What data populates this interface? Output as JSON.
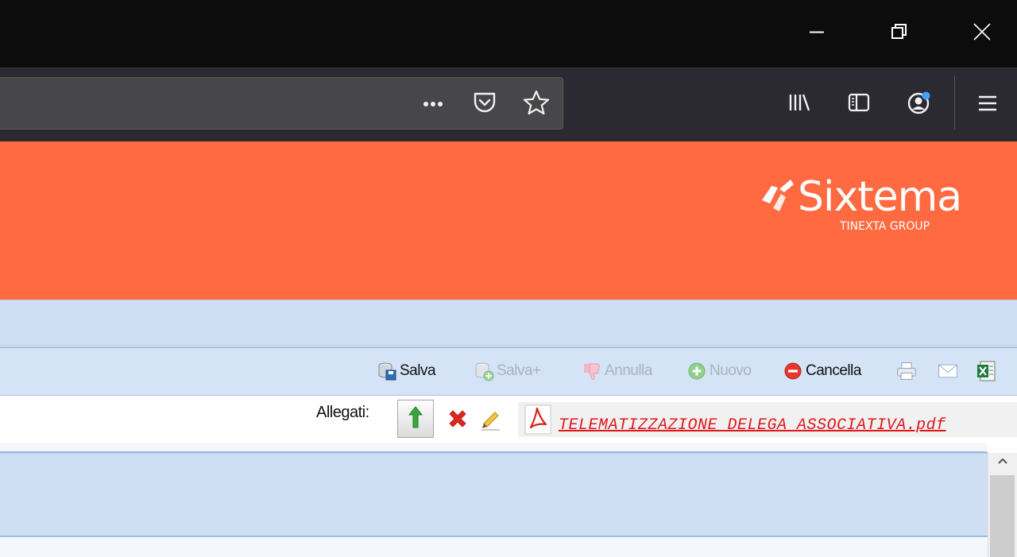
{
  "window": {
    "controls": {
      "minimize_icon": "minimize-icon",
      "restore_icon": "restore-icon",
      "close_icon": "close-icon"
    }
  },
  "browser": {
    "page_actions_icon": "ellipsis-icon",
    "pocket_icon": "pocket-icon",
    "bookmark_icon": "star-icon",
    "library_icon": "library-icon",
    "sidebar_icon": "sidebar-icon",
    "account_icon": "account-icon",
    "menu_icon": "hamburger-menu-icon"
  },
  "brand": {
    "name": "Sixtema",
    "tagline": "TINEXTA GROUP",
    "banner_color": "#ff6a40"
  },
  "toolbar": {
    "save_label": "Salva",
    "save_plus_label": "Salva+",
    "cancel_edit_label": "Annulla",
    "new_label": "Nuovo",
    "delete_label": "Cancella",
    "print_icon": "print-icon",
    "email_icon": "email-icon",
    "excel_icon": "excel-icon"
  },
  "attachments": {
    "label": "Allegati:",
    "upload_icon": "upload-arrow-icon",
    "remove_icon": "red-x-icon",
    "edit_icon": "pencil-icon",
    "pdf_icon": "pdf-icon",
    "file_name": "TELEMATIZZAZIONE_DELEGA_ASSOCIATIVA.pdf"
  },
  "scrollbar": {
    "up_icon": "chevron-up-icon"
  }
}
